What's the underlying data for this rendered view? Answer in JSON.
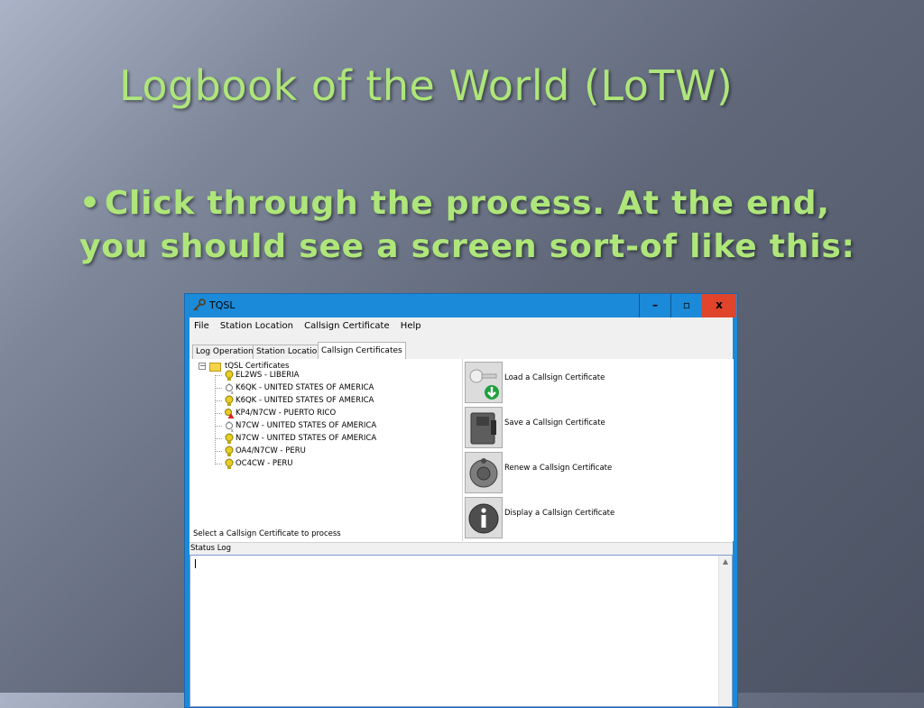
{
  "slide": {
    "title": "Logbook of the World (LoTW)",
    "bullet": "Click through the process.  At the end, you should see a screen sort-of like this:"
  },
  "window": {
    "title": "TQSL",
    "controls": {
      "minimize": "–",
      "maximize": "▫",
      "close": "x"
    },
    "menu": [
      "File",
      "Station Location",
      "Callsign Certificate",
      "Help"
    ],
    "tabs": [
      "Log Operations",
      "Station Locations",
      "Callsign Certificates"
    ],
    "active_tab": "Callsign Certificates",
    "tree": {
      "root_label": "tQSL Certificates",
      "items": [
        {
          "label": "EL2WS - LIBERIA",
          "icon": "valid-certificate-icon"
        },
        {
          "label": "K6QK - UNITED STATES OF AMERICA",
          "icon": "pending-certificate-icon"
        },
        {
          "label": "K6QK - UNITED STATES OF AMERICA",
          "icon": "valid-certificate-icon"
        },
        {
          "label": "KP4/N7CW - PUERTO RICO",
          "icon": "expired-certificate-icon"
        },
        {
          "label": "N7CW - UNITED STATES OF AMERICA",
          "icon": "pending-certificate-icon"
        },
        {
          "label": "N7CW - UNITED STATES OF AMERICA",
          "icon": "valid-certificate-icon"
        },
        {
          "label": "OA4/N7CW - PERU",
          "icon": "valid-certificate-icon"
        },
        {
          "label": "OC4CW - PERU",
          "icon": "valid-certificate-icon"
        }
      ]
    },
    "status_text": "Select a Callsign Certificate to process",
    "actions": [
      {
        "label": "Load a Callsign Certificate",
        "icon": "load-certificate-icon"
      },
      {
        "label": "Save a Callsign Certificate",
        "icon": "save-certificate-icon"
      },
      {
        "label": "Renew a Callsign Certificate",
        "icon": "renew-certificate-icon"
      },
      {
        "label": "Display a Callsign Certificate",
        "icon": "info-icon"
      }
    ],
    "status_log_label": "Status Log",
    "status_log_value": ""
  }
}
